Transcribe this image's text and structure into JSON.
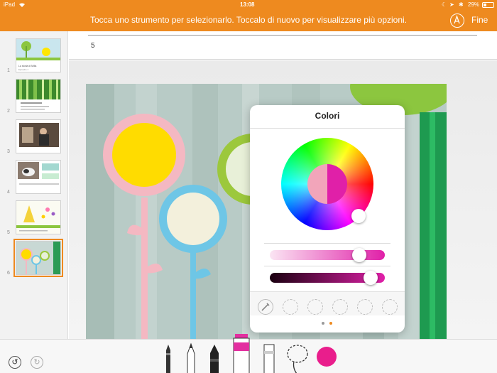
{
  "status_bar": {
    "device": "iPad",
    "time": "13:08",
    "battery": "29%"
  },
  "toolbar": {
    "message": "Tocca uno strumento per selezionarlo. Toccalo di nuovo per visualizzare più opzioni.",
    "done_label": "Fine",
    "pen_icon": "pen-circle-icon"
  },
  "thumbnails": [
    {
      "number": "1",
      "title": "La storia di Milla",
      "subtitle": "Episodio 1"
    },
    {
      "number": "2"
    },
    {
      "number": "3"
    },
    {
      "number": "4"
    },
    {
      "number": "5"
    },
    {
      "number": "6",
      "selected": true
    }
  ],
  "notes": {
    "text": "5"
  },
  "color_popover": {
    "title": "Colori",
    "current_colors": {
      "previous": "#f2a5ba",
      "new": "#e020a8"
    },
    "brightness_level": 0.82,
    "opacity_level": 0.93,
    "palette_slots": 6,
    "page_count": 2,
    "current_page": 2
  },
  "tools": [
    {
      "name": "pen-tool"
    },
    {
      "name": "pencil-tool"
    },
    {
      "name": "crayon-tool"
    },
    {
      "name": "fill-tool",
      "selected": true,
      "color": "#e32fa0"
    },
    {
      "name": "eraser-tool"
    },
    {
      "name": "lasso-tool"
    },
    {
      "name": "color-picker",
      "color": "#e91e8c"
    }
  ],
  "colors": {
    "accent": "#ee8a1f",
    "selected_color": "#e91e8c"
  }
}
